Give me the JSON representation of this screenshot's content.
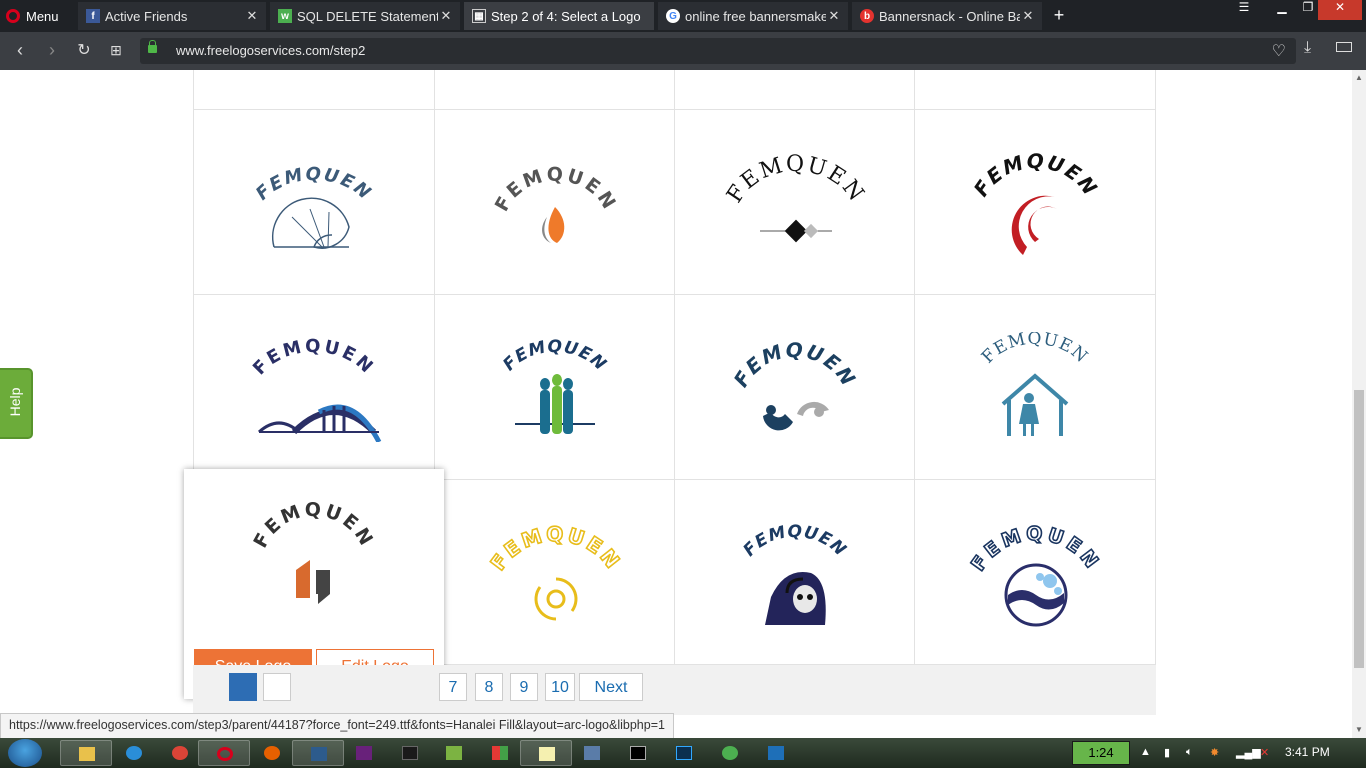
{
  "browser": {
    "menu_label": "Menu",
    "tabs": [
      {
        "title": "Active Friends",
        "icon": "facebook-icon",
        "active": false
      },
      {
        "title": "SQL DELETE Statement",
        "icon": "w3schools-icon",
        "active": false
      },
      {
        "title": "Step 2 of 4: Select a Logo",
        "icon": "grid-icon",
        "active": true
      },
      {
        "title": "online free bannersmakers",
        "icon": "google-icon",
        "active": false
      },
      {
        "title": "Bannersnack - Online Banner",
        "icon": "bannersnack-icon",
        "active": false
      }
    ],
    "new_tab": "+",
    "url": "www.freelogoservices.com/step2"
  },
  "help": {
    "label": "Help"
  },
  "logos": {
    "brand_text": "FEMQUEN"
  },
  "popup": {
    "save_label": "Save Logo",
    "edit_label": "Edit Logo"
  },
  "pagination": {
    "pages": [
      "7",
      "8",
      "9",
      "10"
    ],
    "next_label": "Next"
  },
  "status_url": "https://www.freelogoservices.com/step3/parent/44187?force_font=249.ttf&fonts=Hanalei Fill&layout=arc-logo&libphp=1",
  "taskbar": {
    "timer": "1:24",
    "clock": "3:41 PM"
  },
  "colors": {
    "accent_orange": "#ed7336",
    "help_green": "#6cac3a",
    "page_link_blue": "#1a6cb0"
  }
}
